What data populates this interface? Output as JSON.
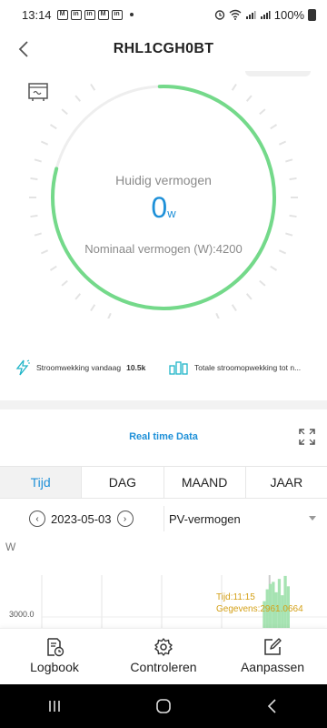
{
  "status_bar": {
    "time": "13:14",
    "notification_icons": [
      "M",
      "in",
      "in",
      "M",
      "in"
    ],
    "battery": "100%"
  },
  "header": {
    "title": "RHL1CGH0BT"
  },
  "gauge": {
    "label": "Huidig vermogen",
    "value": "0",
    "unit": "w",
    "nominal": "Nominaal vermogen (W):4200",
    "fill_fraction": 1.0,
    "accent_color": "#74d98a",
    "value_color": "#1e90d8"
  },
  "stats": {
    "today_label": "Stroomwekking vandaag",
    "today_value": "10.5k",
    "total_label": "Totale stroomopwekking tot n..."
  },
  "realtime": {
    "title": "Real time Data"
  },
  "tabs": [
    {
      "label": "Tijd"
    },
    {
      "label": "DAG"
    },
    {
      "label": "MAAND"
    },
    {
      "label": "JAAR"
    }
  ],
  "date_nav": {
    "date": "2023-05-03",
    "selected_metric": "PV-vermogen"
  },
  "chart": {
    "unit": "W",
    "tick": "3000.0",
    "tooltip_time": "Tijd:11:15",
    "tooltip_value": "Gegevens:2961.0664"
  },
  "chart_data": {
    "type": "area",
    "ylabel": "W",
    "y_ticks": [
      "3000.0"
    ],
    "selected_point": {
      "x": "11:15",
      "y": 2961.0664
    },
    "series": [
      {
        "values": [
          0,
          0,
          0,
          0,
          0,
          0,
          0,
          0,
          0,
          0,
          0,
          1800,
          2600,
          2961.0664,
          3100,
          2400,
          3300,
          2200,
          3500,
          2800
        ]
      }
    ]
  },
  "bottom_nav": [
    {
      "label": "Logbook",
      "icon": "logbook-icon"
    },
    {
      "label": "Controleren",
      "icon": "gear-icon"
    },
    {
      "label": "Aanpassen",
      "icon": "edit-icon"
    }
  ]
}
